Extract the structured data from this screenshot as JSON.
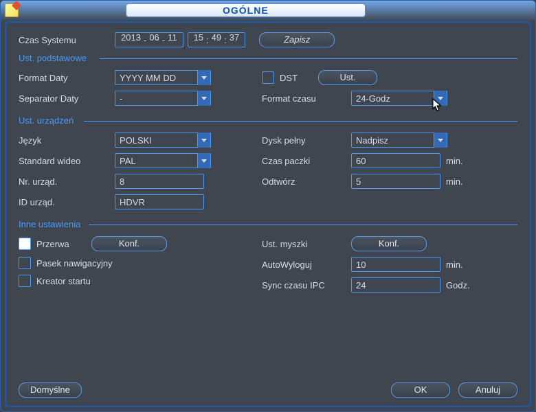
{
  "title": "OGÓLNE",
  "systemTime": {
    "label": "Czas Systemu",
    "y": "2013",
    "mo": "06",
    "d": "11",
    "h": "15",
    "mi": "49",
    "s": "37",
    "save": "Zapisz"
  },
  "sections": {
    "basic": "Ust. podstawowe",
    "device": "Ust. urządzeń",
    "other": "Inne ustawienia"
  },
  "basic": {
    "dateFormat": {
      "label": "Format Daty",
      "value": "YYYY MM DD"
    },
    "dst": {
      "label": "DST",
      "btn": "Ust."
    },
    "dateSep": {
      "label": "Separator Daty",
      "value": "-"
    },
    "timeFormat": {
      "label": "Format czasu",
      "value": "24-Godz"
    }
  },
  "device": {
    "lang": {
      "label": "Język",
      "value": "POLSKI"
    },
    "hddFull": {
      "label": "Dysk pełny",
      "value": "Nadpisz"
    },
    "videoStd": {
      "label": "Standard wideo",
      "value": "PAL"
    },
    "packTime": {
      "label": "Czas paczki",
      "value": "60",
      "unit": "min."
    },
    "devNo": {
      "label": "Nr. urząd.",
      "value": "8"
    },
    "playback": {
      "label": "Odtwórz",
      "value": "5",
      "unit": "min."
    },
    "devId": {
      "label": "ID urząd.",
      "value": "HDVR"
    }
  },
  "other": {
    "interval": {
      "label": "Przerwa",
      "btn": "Konf."
    },
    "mouse": {
      "label": "Ust. myszki",
      "btn": "Konf."
    },
    "navbar": {
      "label": "Pasek nawigacyjny"
    },
    "autoLogout": {
      "label": "AutoWyloguj",
      "value": "10",
      "unit": "min."
    },
    "wizard": {
      "label": "Kreator startu"
    },
    "ipcSync": {
      "label": "Sync czasu IPC",
      "value": "24",
      "unit": "Godz."
    }
  },
  "footer": {
    "default": "Domyślne",
    "ok": "OK",
    "cancel": "Anuluj"
  }
}
